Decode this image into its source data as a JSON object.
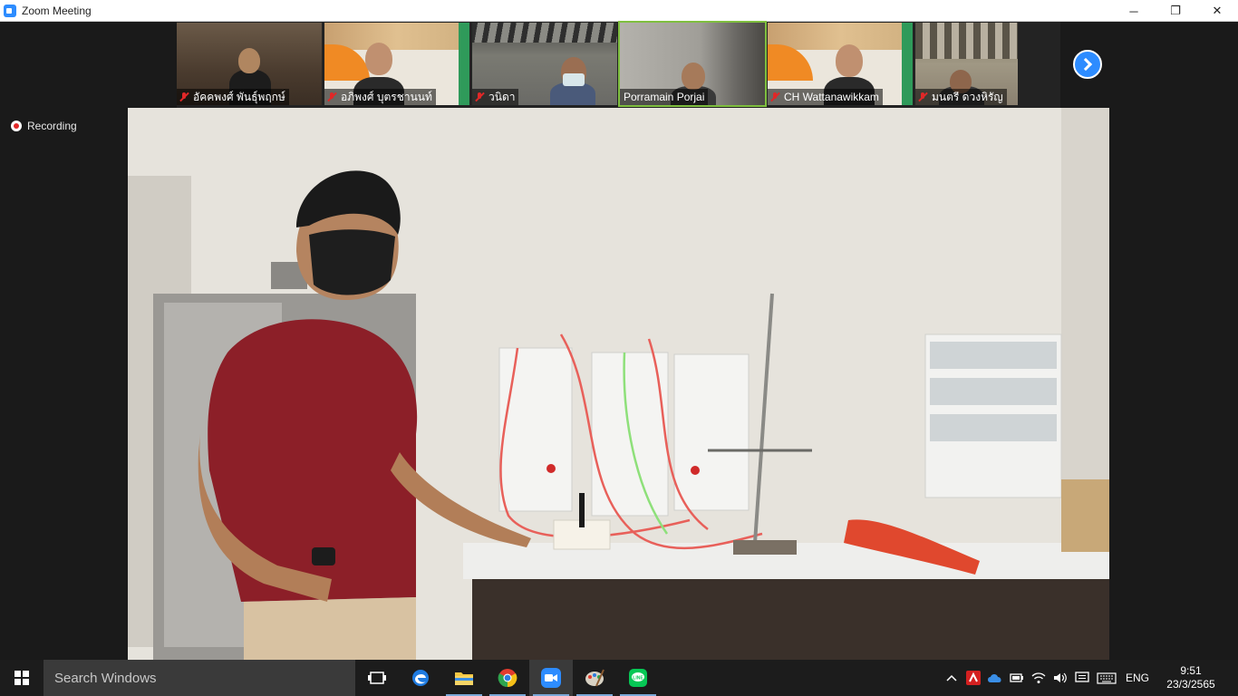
{
  "window": {
    "title": "Zoom Meeting",
    "controls": {
      "minimize": "─",
      "restore": "❐",
      "close": "✕"
    }
  },
  "participants": [
    {
      "name": "อัคคพงศ์ พันธุ์พฤกษ์",
      "muted": true,
      "active": false,
      "bg": "#5a4838"
    },
    {
      "name": "อภิพงศ์ บุตรชานนท์",
      "muted": true,
      "active": false,
      "bg": "#e8e2d6"
    },
    {
      "name": "วนิดา",
      "muted": true,
      "active": false,
      "bg": "#6e6e68"
    },
    {
      "name": "Porramain Porjai",
      "muted": false,
      "active": true,
      "bg": "#9c9a94"
    },
    {
      "name": "CH Wattanawikkam",
      "muted": true,
      "active": false,
      "bg": "#e8e2d6"
    },
    {
      "name": "มนตรี ดวงหิรัญ",
      "muted": true,
      "active": false,
      "bg": "#8a8070"
    }
  ],
  "recording": {
    "label": "Recording"
  },
  "taskbar": {
    "search_placeholder": "Search Windows",
    "apps": [
      "task-view",
      "edge",
      "file-explorer",
      "chrome",
      "zoom",
      "paint",
      "line"
    ],
    "language": "ENG",
    "time": "9:51",
    "date": "23/3/2565"
  },
  "colors": {
    "zoom_blue": "#2d8cff",
    "mute_red": "#e02828",
    "active_speaker": "#7fbf3f",
    "shirt": "#8c1f28"
  }
}
